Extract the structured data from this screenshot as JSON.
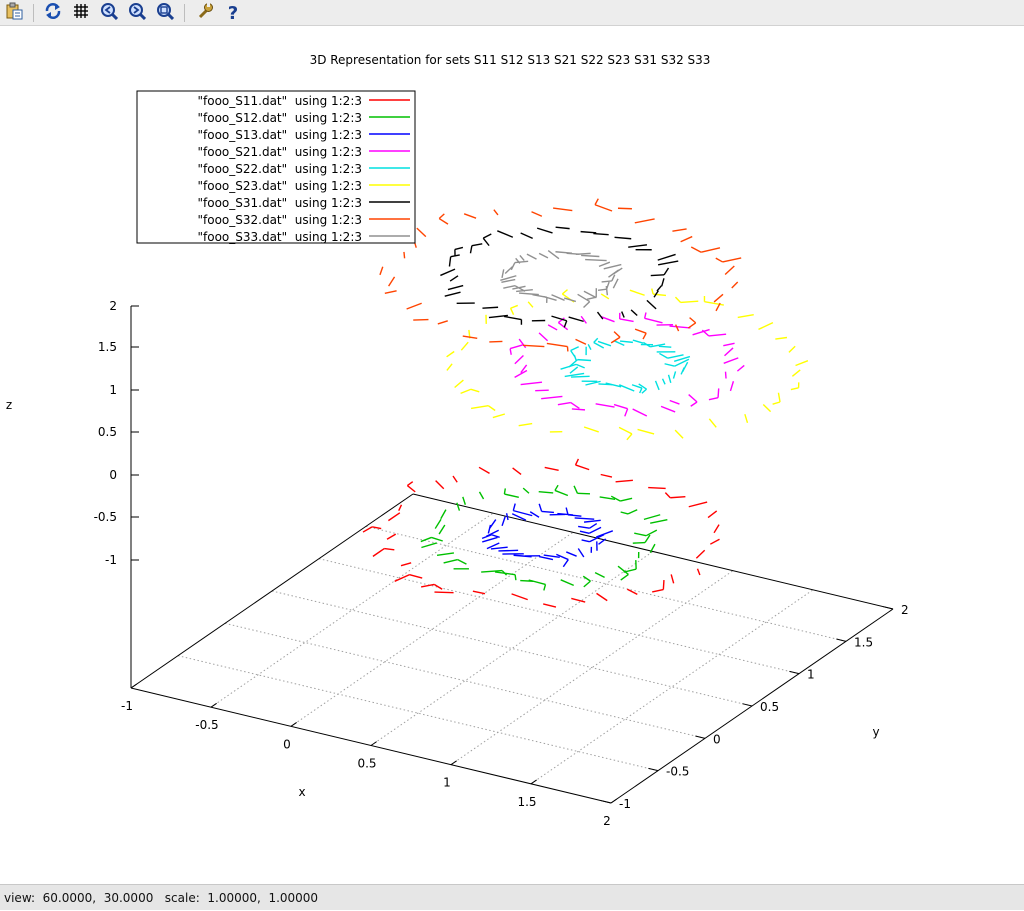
{
  "toolbar": {
    "buttons": [
      {
        "name": "copy-to-clipboard-button",
        "icon": "clipboard-icon"
      },
      {
        "name": "replot-button",
        "icon": "refresh-icon"
      },
      {
        "name": "toggle-grid-button",
        "icon": "grid-icon"
      },
      {
        "name": "zoom-previous-button",
        "icon": "zoom-previous-icon"
      },
      {
        "name": "zoom-next-button",
        "icon": "zoom-next-icon"
      },
      {
        "name": "unzoom-button",
        "icon": "unzoom-icon"
      },
      {
        "name": "configure-button",
        "icon": "wrench-icon"
      },
      {
        "name": "help-button",
        "icon": "question-icon"
      }
    ]
  },
  "status": {
    "text": "view:  60.0000,  30.0000   scale:  1.00000,  1.00000"
  },
  "chart_data": {
    "type": "line",
    "projection": "3d",
    "title": "3D Representation for sets S11 S12 S13 S21 S22 S23 S31 S32 S33",
    "xlabel": "x",
    "ylabel": "y",
    "zlabel": "z",
    "xlim": [
      -1,
      2
    ],
    "ylim": [
      -1,
      2
    ],
    "zlim": [
      -1,
      2
    ],
    "view": {
      "rot_x": 60,
      "rot_z": 30,
      "scale": 1.0,
      "scale_z": 1.0
    },
    "x_ticks": [
      "-1",
      "-0.5",
      "0",
      "0.5",
      "1",
      "1.5",
      "2"
    ],
    "y_ticks": [
      "-1",
      "-0.5",
      "0",
      "0.5",
      "1",
      "1.5",
      "2"
    ],
    "z_ticks": [
      "2",
      "1.5",
      "1",
      "0.5",
      "0",
      "-0.5",
      "-1"
    ],
    "grid": true,
    "legend_position": "top-left",
    "series": [
      {
        "name": "\"fooo_S11.dat\"  using 1:2:3",
        "color": "#ff0000",
        "center": [
          1,
          0,
          0
        ],
        "ring_radius": 0.9
      },
      {
        "name": "\"fooo_S12.dat\"  using 1:2:3",
        "color": "#00c000",
        "center": [
          1,
          0,
          0
        ],
        "ring_radius": 0.6
      },
      {
        "name": "\"fooo_S13.dat\"  using 1:2:3",
        "color": "#0000ff",
        "center": [
          1,
          0,
          0
        ],
        "ring_radius": 0.3
      },
      {
        "name": "\"fooo_S21.dat\"  using 1:2:3",
        "color": "#ff00ff",
        "center": [
          0.8,
          1.2,
          1
        ],
        "ring_radius": 0.6
      },
      {
        "name": "\"fooo_S22.dat\"  using 1:2:3",
        "color": "#00e0e0",
        "center": [
          0.8,
          1.2,
          1
        ],
        "ring_radius": 0.3
      },
      {
        "name": "\"fooo_S23.dat\"  using 1:2:3",
        "color": "#ffff00",
        "center": [
          0.8,
          1.2,
          1
        ],
        "ring_radius": 0.9
      },
      {
        "name": "\"fooo_S31.dat\"  using 1:2:3",
        "color": "#000000",
        "center": [
          0.1,
          1.7,
          1.35
        ],
        "ring_radius": 0.6
      },
      {
        "name": "\"fooo_S32.dat\"  using 1:2:3",
        "color": "#ff4400",
        "center": [
          0.1,
          1.7,
          1.35
        ],
        "ring_radius": 0.9
      },
      {
        "name": "\"fooo_S33.dat\"  using 1:2:3",
        "color": "#909090",
        "center": [
          0.1,
          1.7,
          1.35
        ],
        "ring_radius": 0.3
      }
    ]
  }
}
